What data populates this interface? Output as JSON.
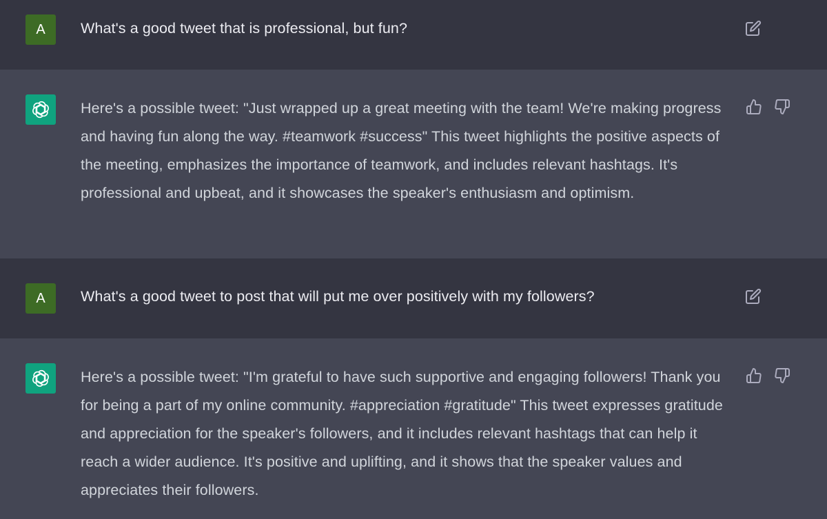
{
  "messages": [
    {
      "role": "user",
      "avatar_letter": "A",
      "text": "What's a good tweet that is professional, but fun?"
    },
    {
      "role": "assistant",
      "text": "Here's a possible tweet: \"Just wrapped up a great meeting with the team! We're making progress and having fun along the way. #teamwork #success\" This tweet highlights the positive aspects of the meeting, emphasizes the importance of teamwork, and includes relevant hashtags. It's professional and upbeat, and it showcases the speaker's enthusiasm and optimism."
    },
    {
      "role": "user",
      "avatar_letter": "A",
      "text": "What's a good tweet to post that will put me over positively with my followers?"
    },
    {
      "role": "assistant",
      "text": "Here's a possible tweet: \"I'm grateful to have such supportive and engaging followers! Thank you for being a part of my online community. #appreciation #gratitude\" This tweet expresses gratitude and appreciation for the speaker's followers, and it includes relevant hashtags that can help it reach a wider audience. It's positive and uplifting, and it shows that the speaker values and appreciates their followers."
    }
  ],
  "icons": {
    "edit": "edit-icon",
    "thumbs_up": "thumbs-up-icon",
    "thumbs_down": "thumbs-down-icon",
    "bot_logo": "openai-logo-icon"
  },
  "colors": {
    "user_bg": "#343541",
    "assistant_bg": "#444654",
    "user_avatar": "#3d6b25",
    "bot_avatar": "#10a37f"
  }
}
